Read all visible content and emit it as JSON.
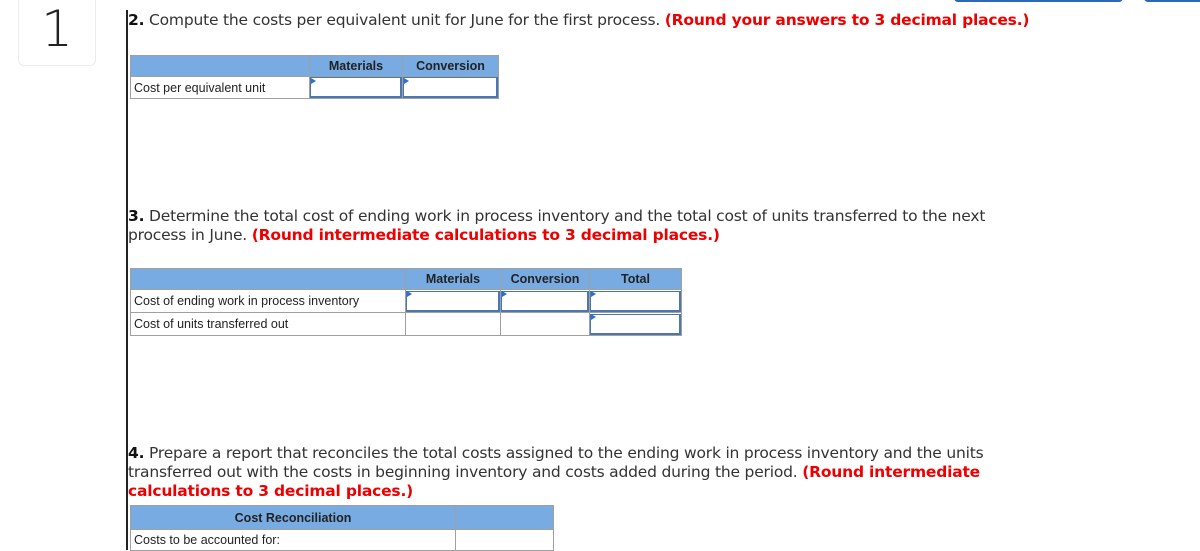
{
  "question_number": "1",
  "colors": {
    "header_blue": "#78abe2",
    "instruction_red": "#ee0000",
    "input_marker": "#2d6fc9"
  },
  "part2": {
    "number": "2.",
    "text": " Compute the costs per equivalent unit for June for the first process. ",
    "instruction": "(Round your answers to 3 decimal places.)",
    "table": {
      "headers": [
        "",
        "Materials",
        "Conversion"
      ],
      "rows": [
        {
          "label": "Cost per equivalent unit",
          "materials": "",
          "conversion": ""
        }
      ]
    }
  },
  "part3": {
    "number": "3.",
    "text": " Determine the total cost of ending work in process inventory and the total cost of units transferred to the next process in June. ",
    "instruction": "(Round intermediate calculations to 3 decimal places.)",
    "table": {
      "headers": [
        "",
        "Materials",
        "Conversion",
        "Total"
      ],
      "rows": [
        {
          "label": "Cost of ending work in process inventory",
          "materials": "",
          "conversion": "",
          "total": ""
        },
        {
          "label": "Cost of units transferred out",
          "total": ""
        }
      ]
    }
  },
  "part4": {
    "number": "4.",
    "text": " Prepare a report that reconciles the total costs assigned to the ending work in process inventory and the units transferred out with the costs in beginning inventory and costs added during the period. ",
    "instruction": "(Round intermediate calculations to 3 decimal places.)",
    "table": {
      "headers": [
        "Cost Reconciliation",
        ""
      ],
      "rows": [
        {
          "label": "Costs to be accounted for:"
        }
      ]
    }
  }
}
